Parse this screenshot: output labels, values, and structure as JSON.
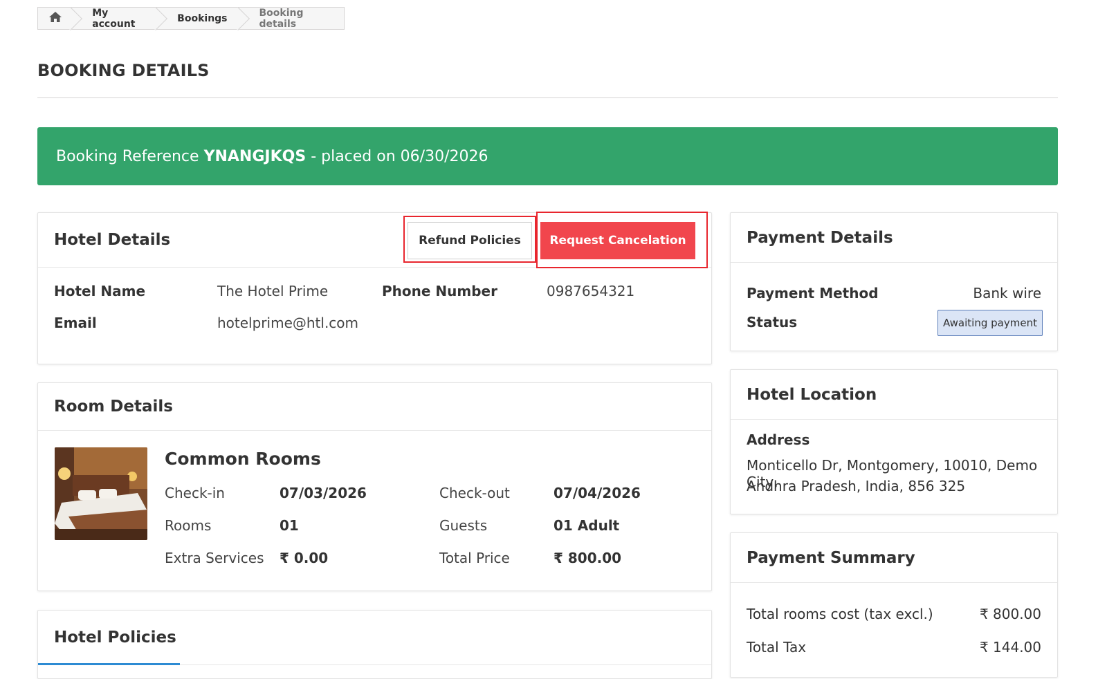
{
  "breadcrumb": {
    "home_icon": "home-icon",
    "items": [
      "My account",
      "Bookings",
      "Booking details"
    ]
  },
  "page": {
    "title": "BOOKING DETAILS"
  },
  "banner": {
    "prefix": "Booking Reference",
    "reference": "YNANGJKQS",
    "suffix": "- placed on 06/30/2026",
    "color": "#33a46b"
  },
  "hotel_details": {
    "title": "Hotel Details",
    "refund_label": "Refund Policies",
    "cancel_label": "Request Cancelation",
    "fields": {
      "hotel_name_label": "Hotel Name",
      "hotel_name": "The Hotel Prime",
      "phone_label": "Phone Number",
      "phone": "0987654321",
      "email_label": "Email",
      "email": "hotelprime@htl.com"
    }
  },
  "room_details": {
    "title": "Room Details",
    "room_name": "Common Rooms",
    "checkin_label": "Check-in",
    "checkin": "07/03/2026",
    "checkout_label": "Check-out",
    "checkout": "07/04/2026",
    "rooms_label": "Rooms",
    "rooms": "01",
    "guests_label": "Guests",
    "guests": "01 Adult",
    "extra_label": "Extra Services",
    "extra": "₹ 0.00",
    "total_label": "Total Price",
    "total": "₹ 800.00"
  },
  "hotel_policies": {
    "title": "Hotel Policies"
  },
  "payment_details": {
    "title": "Payment Details",
    "method_label": "Payment Method",
    "method": "Bank wire",
    "status_label": "Status",
    "status": "Awaiting payment"
  },
  "hotel_location": {
    "title": "Hotel Location",
    "address_label": "Address",
    "address_line1": "Monticello Dr, Montgomery, 10010, Demo City,",
    "address_line2": "Andhra Pradesh, India, 856 325"
  },
  "payment_summary": {
    "title": "Payment Summary",
    "rooms_cost_label": "Total rooms cost (tax excl.)",
    "rooms_cost": "₹ 800.00",
    "tax_label": "Total Tax",
    "tax": "₹ 144.00"
  },
  "colors": {
    "cancel": "#f1464d",
    "highlight": "#e8262e",
    "tab_underline": "#2d8bd3"
  }
}
